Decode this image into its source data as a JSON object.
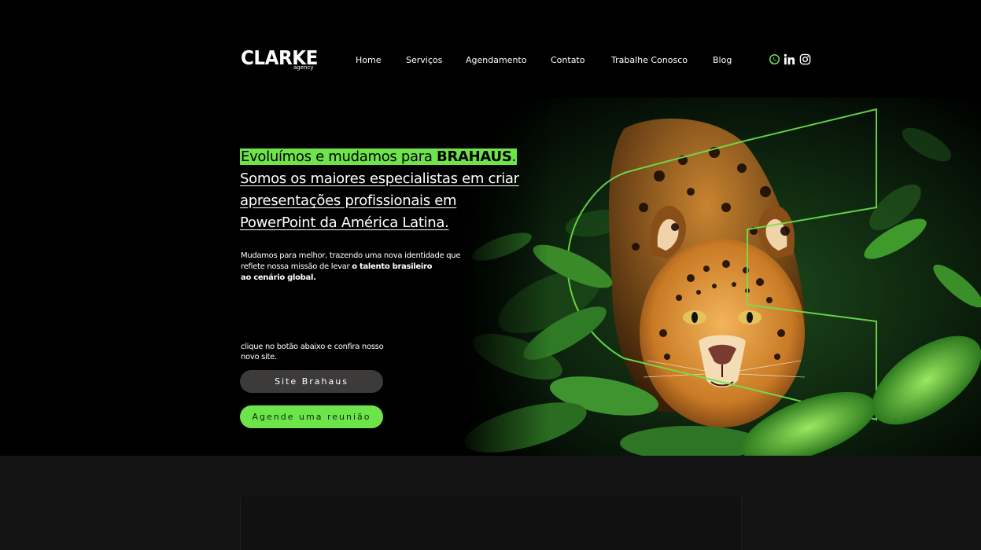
{
  "header": {
    "logo_main": "CLARKE",
    "logo_sub": "agency",
    "nav": [
      "Home",
      "Serviços",
      "Agendamento",
      "Contato",
      "Trabalhe Conosco",
      "Blog"
    ],
    "social": [
      "whatsapp-icon",
      "linkedin-icon",
      "instagram-icon"
    ]
  },
  "hero": {
    "headline_prefix": "Evoluímos e mudamos para ",
    "headline_brand": "BRAHAUS",
    "headline_dot": ".",
    "headline_rest": "Somos os maiores especialistas em criar apresentações profissionais em PowerPoint da América Latina.",
    "desc_part1": "Mudamos para melhor, trazendo uma nova identidade que reflete nossa missão de levar ",
    "desc_bold1": "o talento brasileiro",
    "desc_bold2": "ao cenário global.",
    "cta_text": "clique no botão abaixo e confira nosso novo site.",
    "btn_site": "Site Brahaus",
    "btn_meeting": "Agende uma reunião",
    "image_alt": "jaguar-in-jungle"
  },
  "colors": {
    "accent": "#6ee44b",
    "button_dark": "#3d3a3a",
    "background": "#000000",
    "lower_section": "#141414"
  }
}
